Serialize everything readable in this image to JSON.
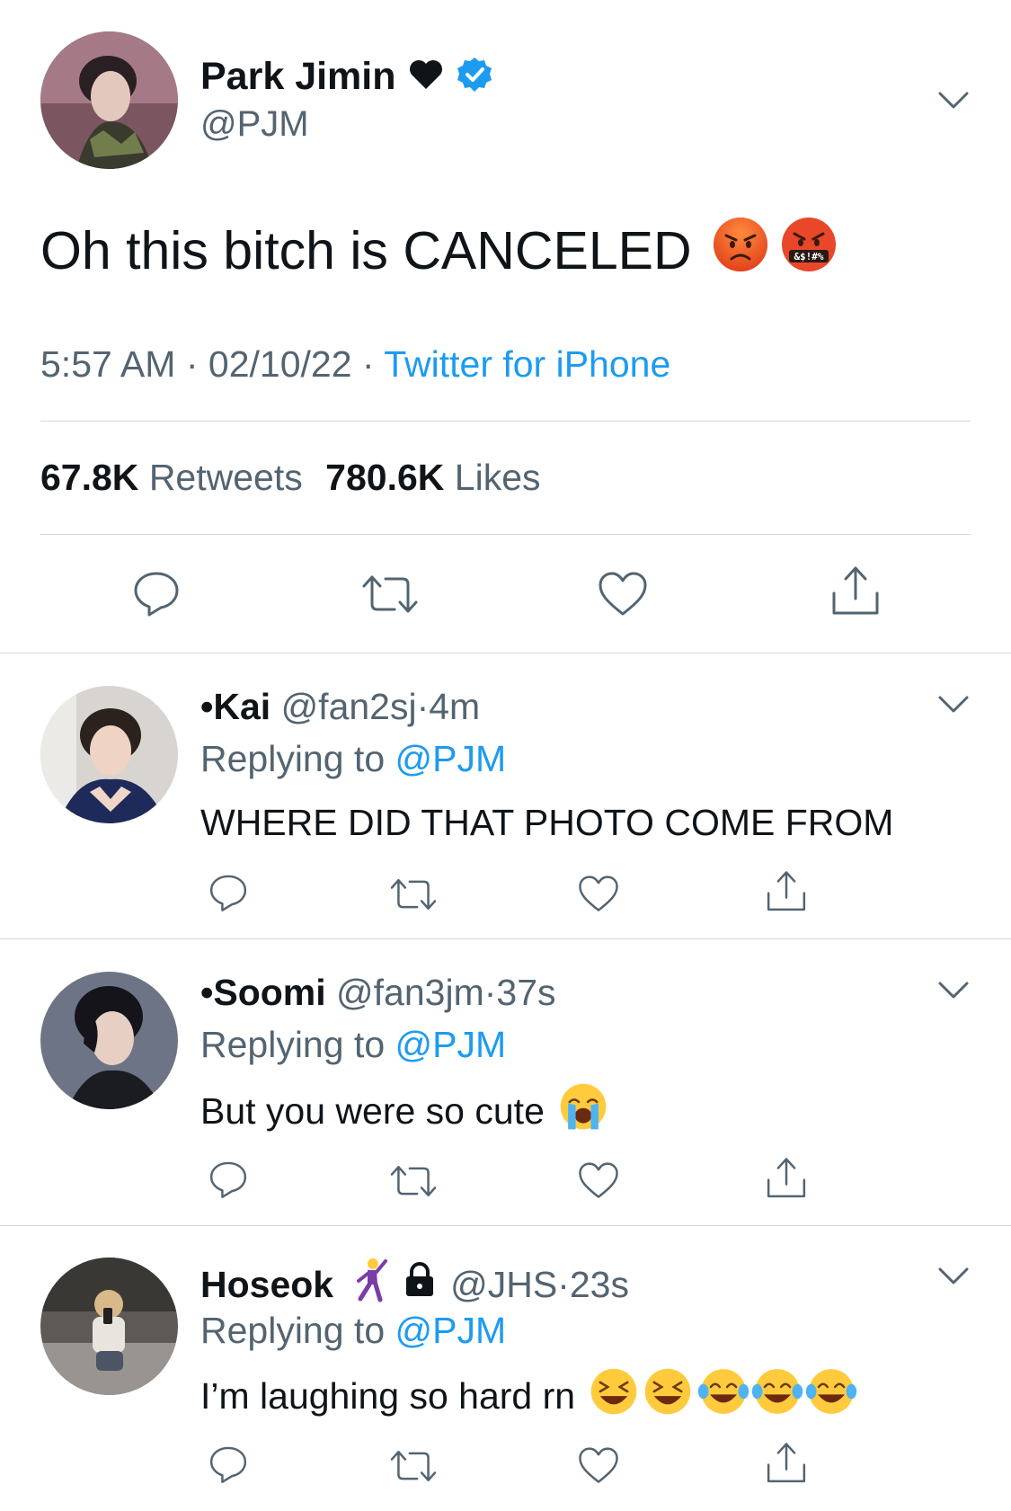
{
  "colors": {
    "accent": "#1d9bf0",
    "muted": "#536471",
    "text": "#0f1419",
    "divider": "#cfd9de"
  },
  "main_tweet": {
    "display_name": "Park Jimin",
    "name_emoji": "black-heart-icon",
    "verified": true,
    "handle": "@PJM",
    "text": "Oh this bitch is CANCELED",
    "text_emojis": [
      "pouting-face-icon",
      "face-with-symbols-on-mouth-icon"
    ],
    "time": "5:57 AM",
    "date": "02/10/22",
    "source": "Twitter for iPhone",
    "retweets_count": "67.8K",
    "retweets_label": "Retweets",
    "likes_count": "780.6K",
    "likes_label": "Likes",
    "actions": [
      "reply-icon",
      "retweet-icon",
      "like-icon",
      "share-icon"
    ]
  },
  "replies": [
    {
      "name": "•Kai",
      "handle": "@fan2sj",
      "time": "4m",
      "replying_prefix": "Replying to",
      "replying_to": "@PJM",
      "text": "WHERE DID THAT PHOTO COME FROM"
    },
    {
      "name": "•Soomi",
      "handle": "@fan3jm",
      "time": "37s",
      "replying_prefix": "Replying to",
      "replying_to": "@PJM",
      "text": "But you were so cute",
      "text_emojis": [
        "loudly-crying-face-icon"
      ]
    },
    {
      "name": "Hoseok",
      "name_emojis": [
        "man-dancing-icon",
        "lock-icon"
      ],
      "handle": "@JHS",
      "time": "23s",
      "replying_prefix": "Replying to",
      "replying_to": "@PJM",
      "text": "I’m laughing so hard rn",
      "text_emojis": [
        "grinning-squinting-face-icon",
        "grinning-squinting-face-icon",
        "face-with-tears-of-joy-icon",
        "face-with-tears-of-joy-icon",
        "face-with-tears-of-joy-icon"
      ]
    }
  ],
  "dot": "·"
}
